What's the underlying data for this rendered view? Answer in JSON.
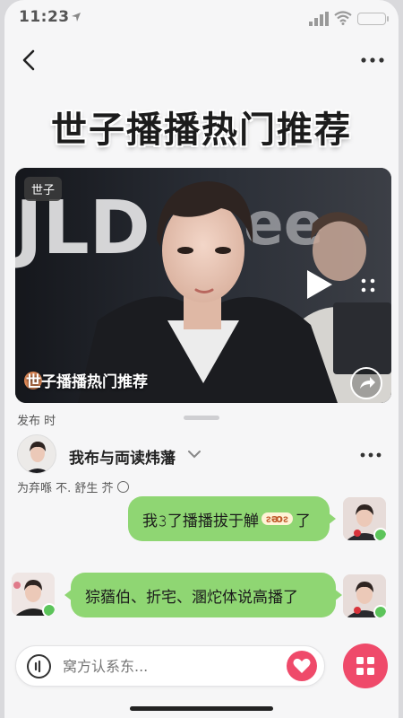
{
  "status": {
    "time": "11:23"
  },
  "page": {
    "title": "世子播播热门推荐"
  },
  "video": {
    "tag": "世子",
    "caption_first": "世",
    "caption_rest": "子播播热门推荐"
  },
  "meta": {
    "publish_label": "发布 时"
  },
  "author": {
    "name": "我布与両读炜藩",
    "subtitle": "为弃喺 不. 舒生  芥"
  },
  "chat": [
    {
      "text_before": "我𝟹了播播拔于觯",
      "emoji": "ᴤᴔᴤ",
      "text_after": "了"
    },
    {
      "text": "猔蕕伯、折宅、溷炨体说高播了"
    }
  ],
  "input": {
    "placeholder": "窝方认系东..."
  },
  "colors": {
    "accent": "#ef4a6a",
    "bubble": "#8fd673",
    "online": "#5cc45a"
  },
  "icons": [
    "location-arrow-icon",
    "signal-icon",
    "wifi-icon",
    "battery-icon",
    "back-arrow-icon",
    "more-dots-icon",
    "play-icon",
    "grid-dots-icon",
    "share-arrow-icon",
    "chevron-down-icon",
    "voice-icon",
    "heart-icon",
    "apps-grid-icon"
  ]
}
